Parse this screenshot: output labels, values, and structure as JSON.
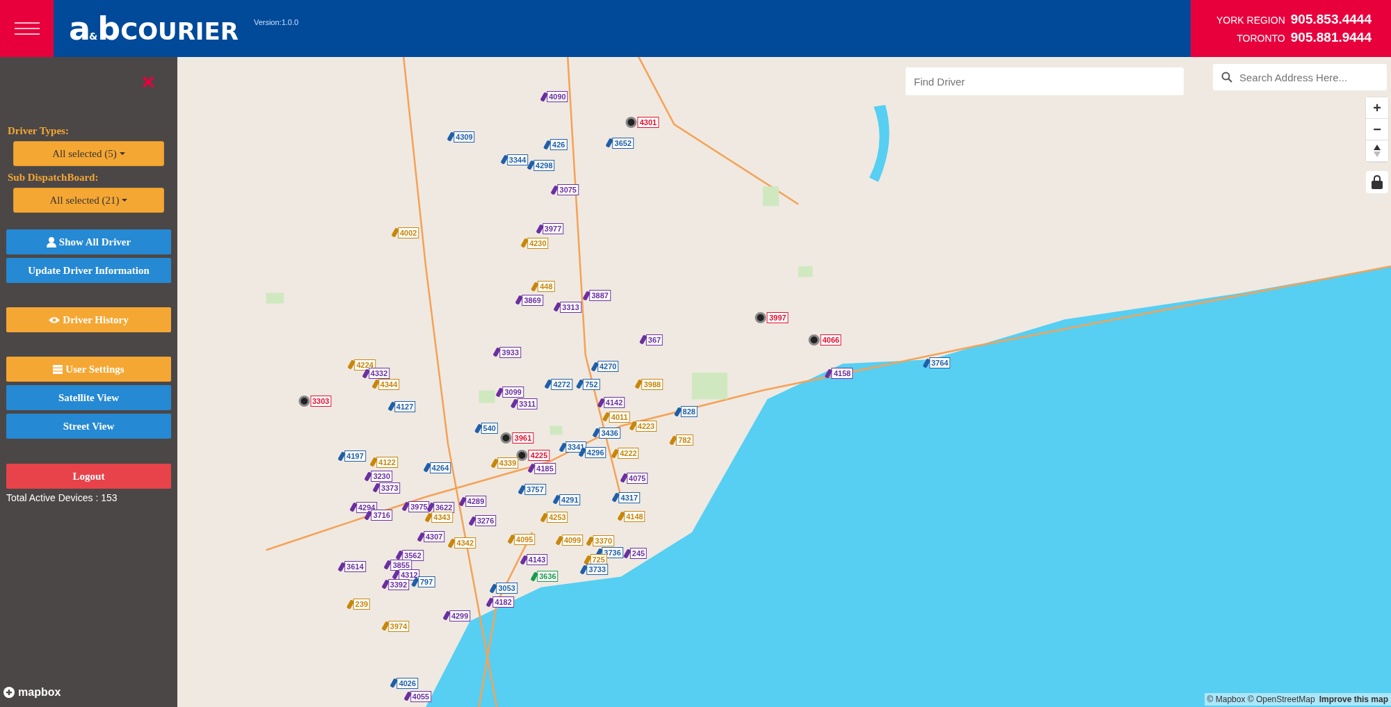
{
  "header": {
    "logo": {
      "mark_a": "a",
      "mark_amp": "&",
      "mark_b": "b",
      "name": "COURIER"
    },
    "version": "Version:1.0.0",
    "phones": [
      {
        "region": "YORK REGION",
        "number": "905.853.4444"
      },
      {
        "region": "TORONTO",
        "number": "905.881.9444"
      }
    ]
  },
  "sidebar": {
    "close": "×",
    "filters": [
      {
        "label": "Driver Types:",
        "value": "All selected (5)"
      },
      {
        "label": "Sub DispatchBoard:",
        "value": "All selected (21)"
      }
    ],
    "buttons": [
      {
        "label": "Show All Driver",
        "kind": "primary"
      },
      {
        "label": "Update Driver Information",
        "kind": "primary"
      },
      {
        "label": "Driver History",
        "kind": "warning"
      },
      {
        "label": "User Settings",
        "kind": "warning"
      },
      {
        "label": "Satellite View",
        "kind": "primary"
      },
      {
        "label": "Street View",
        "kind": "primary"
      },
      {
        "label": "Logout",
        "kind": "danger"
      }
    ],
    "total": "Total Active Devices : 153"
  },
  "map": {
    "find_driver": {
      "placeholder": "Find Driver"
    },
    "search": {
      "placeholder": "Search Address Here..."
    },
    "zoom_in": "+",
    "zoom_out": "−",
    "attribution": "© Mapbox © OpenStreetMap",
    "improve": "Improve this map",
    "brand": "mapbox",
    "drivers": [
      {
        "label": "4090",
        "color": "#6a2fa0"
      },
      {
        "label": "4301",
        "color": "#e0102f"
      },
      {
        "label": "4309",
        "color": "#1f5fa8"
      },
      {
        "label": "426",
        "color": "#1f5fa8"
      },
      {
        "label": "3652",
        "color": "#1f5fa8"
      },
      {
        "label": "3344",
        "color": "#1f5fa8"
      },
      {
        "label": "4298",
        "color": "#1f5fa8"
      },
      {
        "label": "3075",
        "color": "#6a2fa0"
      },
      {
        "label": "4002",
        "color": "#c8860a"
      },
      {
        "label": "3977",
        "color": "#6a2fa0"
      },
      {
        "label": "4230",
        "color": "#c8860a"
      },
      {
        "label": "448",
        "color": "#c8860a"
      },
      {
        "label": "3869",
        "color": "#6a2fa0"
      },
      {
        "label": "3887",
        "color": "#6a2fa0"
      },
      {
        "label": "3313",
        "color": "#6a2fa0"
      },
      {
        "label": "3997",
        "color": "#e0102f"
      },
      {
        "label": "367",
        "color": "#6a2fa0"
      },
      {
        "label": "4066",
        "color": "#e0102f"
      },
      {
        "label": "3933",
        "color": "#6a2fa0"
      },
      {
        "label": "4224",
        "color": "#c8860a"
      },
      {
        "label": "4270",
        "color": "#1f5fa8"
      },
      {
        "label": "3764",
        "color": "#1f5fa8"
      },
      {
        "label": "4332",
        "color": "#6a2fa0"
      },
      {
        "label": "4158",
        "color": "#6a2fa0"
      },
      {
        "label": "4344",
        "color": "#c8860a"
      },
      {
        "label": "4272",
        "color": "#1f5fa8"
      },
      {
        "label": "752",
        "color": "#1f5fa8"
      },
      {
        "label": "3988",
        "color": "#c8860a"
      },
      {
        "label": "3099",
        "color": "#6a2fa0"
      },
      {
        "label": "3303",
        "color": "#e0102f"
      },
      {
        "label": "4127",
        "color": "#1f5fa8"
      },
      {
        "label": "3311",
        "color": "#6a2fa0"
      },
      {
        "label": "4142",
        "color": "#6a2fa0"
      },
      {
        "label": "828",
        "color": "#1f5fa8"
      },
      {
        "label": "4011",
        "color": "#c8860a"
      },
      {
        "label": "540",
        "color": "#1f5fa8"
      },
      {
        "label": "4223",
        "color": "#c8860a"
      },
      {
        "label": "3436",
        "color": "#1f5fa8"
      },
      {
        "label": "3961",
        "color": "#e0102f"
      },
      {
        "label": "782",
        "color": "#c8860a"
      },
      {
        "label": "3341",
        "color": "#1f5fa8"
      },
      {
        "label": "4197",
        "color": "#1f5fa8"
      },
      {
        "label": "4225",
        "color": "#e0102f"
      },
      {
        "label": "4296",
        "color": "#1f5fa8"
      },
      {
        "label": "4222",
        "color": "#c8860a"
      },
      {
        "label": "4122",
        "color": "#c8860a"
      },
      {
        "label": "4339",
        "color": "#c8860a"
      },
      {
        "label": "4264",
        "color": "#1f5fa8"
      },
      {
        "label": "4185",
        "color": "#6a2fa0"
      },
      {
        "label": "3230",
        "color": "#6a2fa0"
      },
      {
        "label": "4075",
        "color": "#6a2fa0"
      },
      {
        "label": "3373",
        "color": "#6a2fa0"
      },
      {
        "label": "3757",
        "color": "#1f5fa8"
      },
      {
        "label": "4291",
        "color": "#1f5fa8"
      },
      {
        "label": "4317",
        "color": "#1f5fa8"
      },
      {
        "label": "4294",
        "color": "#6a2fa0"
      },
      {
        "label": "3975",
        "color": "#6a2fa0"
      },
      {
        "label": "3622",
        "color": "#6a2fa0"
      },
      {
        "label": "4289",
        "color": "#6a2fa0"
      },
      {
        "label": "3716",
        "color": "#6a2fa0"
      },
      {
        "label": "4343",
        "color": "#c8860a"
      },
      {
        "label": "3276",
        "color": "#6a2fa0"
      },
      {
        "label": "4253",
        "color": "#c8860a"
      },
      {
        "label": "4148",
        "color": "#c8860a"
      },
      {
        "label": "4307",
        "color": "#6a2fa0"
      },
      {
        "label": "4342",
        "color": "#c8860a"
      },
      {
        "label": "4095",
        "color": "#c8860a"
      },
      {
        "label": "4099",
        "color": "#c8860a"
      },
      {
        "label": "3370",
        "color": "#c8860a"
      },
      {
        "label": "3562",
        "color": "#6a2fa0"
      },
      {
        "label": "3736",
        "color": "#1f5fa8"
      },
      {
        "label": "245",
        "color": "#6a2fa0"
      },
      {
        "label": "3855",
        "color": "#6a2fa0"
      },
      {
        "label": "4143",
        "color": "#6a2fa0"
      },
      {
        "label": "725",
        "color": "#c8860a"
      },
      {
        "label": "3614",
        "color": "#6a2fa0"
      },
      {
        "label": "3733",
        "color": "#1f5fa8"
      },
      {
        "label": "4312",
        "color": "#6a2fa0"
      },
      {
        "label": "3636",
        "color": "#1a9a4a"
      },
      {
        "label": "3392",
        "color": "#6a2fa0"
      },
      {
        "label": "797",
        "color": "#1f5fa8"
      },
      {
        "label": "3053",
        "color": "#1f5fa8"
      },
      {
        "label": "239",
        "color": "#c8860a"
      },
      {
        "label": "4182",
        "color": "#6a2fa0"
      },
      {
        "label": "4299",
        "color": "#6a2fa0"
      },
      {
        "label": "3974",
        "color": "#c8860a"
      },
      {
        "label": "4026",
        "color": "#1f5fa8"
      },
      {
        "label": "4055",
        "color": "#6a2fa0"
      }
    ]
  }
}
